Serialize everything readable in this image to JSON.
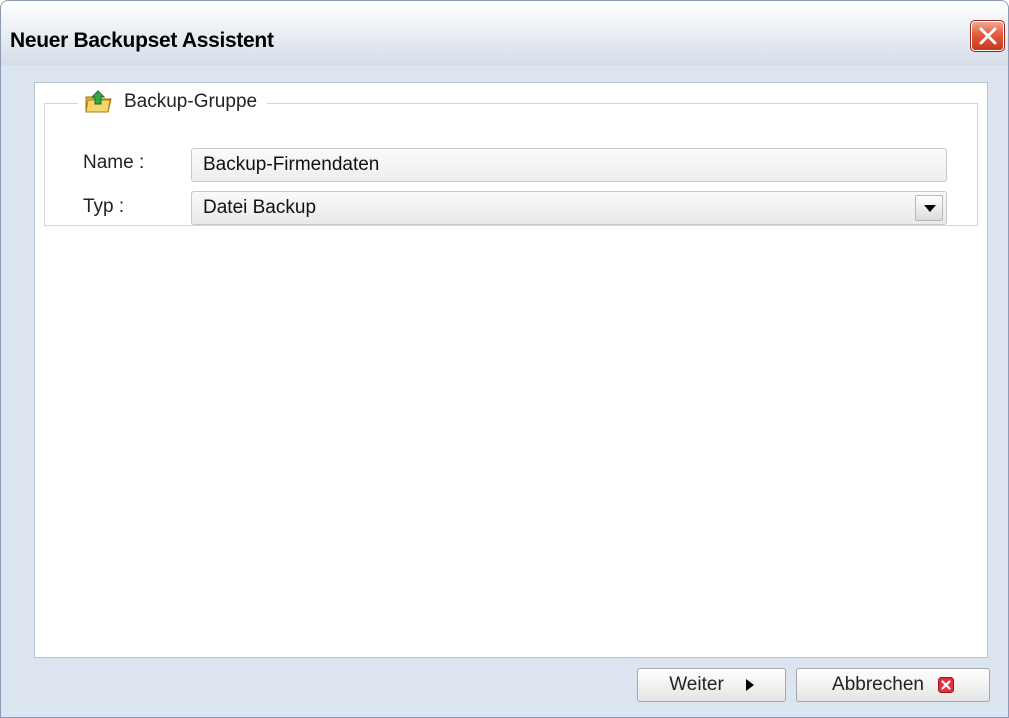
{
  "window": {
    "title": "Neuer Backupset Assistent",
    "close_icon": "close-icon"
  },
  "group": {
    "legend": "Backup-Gruppe",
    "icon": "folder-icon"
  },
  "fields": {
    "name_label": "Name :",
    "name_value": "Backup-Firmendaten",
    "type_label": "Typ :",
    "type_value": "Datei Backup"
  },
  "buttons": {
    "next_label": "Weiter",
    "cancel_label": "Abbrechen"
  },
  "colors": {
    "window_bg": "#dbe4ef",
    "close_red": "#d94a2b",
    "folder_yellow": "#f2c94c",
    "arrow_green": "#2e9e3a"
  }
}
